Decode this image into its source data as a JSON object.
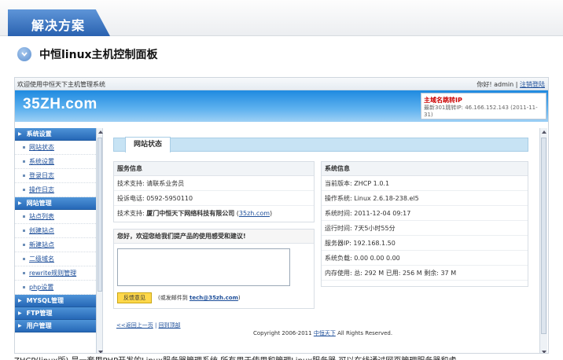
{
  "banner": {
    "title": "解决方案"
  },
  "section": {
    "title": "中恒linux主机控制面板"
  },
  "panel_ui": {
    "welcome": "欢迎使用中恒天下主机管理系统",
    "user_prefix": "你好!",
    "username": "admin",
    "separator": "|",
    "logout": "注销登陆",
    "logo": "35ZH.com",
    "notice_title": "主域名跳转IP",
    "notice_text": "最新301跳转IP: 46.166.152.143 (2011-11-31)"
  },
  "sidebar": {
    "groups": [
      {
        "label": "系统设置",
        "items": [
          "网站状态",
          "系统设置",
          "登录日志",
          "操作日志"
        ]
      },
      {
        "label": "网站管理",
        "items": [
          "站点列表",
          "创建站点",
          "新建站点",
          "二级域名",
          "rewrite规则管理",
          "php设置"
        ]
      },
      {
        "label": "MYSQL管理",
        "items": []
      },
      {
        "label": "FTP管理",
        "items": []
      },
      {
        "label": "用户管理",
        "items": []
      }
    ]
  },
  "main": {
    "tab": "网站状态",
    "service": {
      "title": "服务信息",
      "tech_support": "技术支持: 请联系业务员",
      "complaint": "投诉电话: 0592-5950110",
      "tech_label": "技术支持:",
      "tech_company": "厦门中恒天下网络科技有限公司",
      "tech_link": "35zh.com"
    },
    "system": {
      "title": "系统信息",
      "rows": [
        "当前版本: ZHCP 1.0.1",
        "操作系统: Linux 2.6.18-238.el5",
        "系统时间: 2011-12-04 09:17",
        "运行时间: 7天5小时55分",
        "服务器IP: 192.168.1.50",
        "系统负载: 0.00    0.00    0.00",
        "内存使用: 总: 292 M    已用: 256 M    剩余: 37 M"
      ]
    },
    "feedback": {
      "title": "您好，欢迎您给我们提产品的使用感受和建议!",
      "button": "反馈意见",
      "note_prefix": "(或发邮件到",
      "email": "tech@35zh.com",
      "note_suffix": ")"
    },
    "back_prev": "<<返回上一页",
    "back_home": "回到顶部",
    "copyright": "Copyright 2006-2011",
    "copyright_link": "中恒天下",
    "copyright_suffix": "All Rights Reserved."
  },
  "bottom_text": "ZHCP(linux版) 是一套用PHP开发的Linux服务器管理系统,所有用于使用和管理Linux服务器,可以在线通过网页管理服务器和虚"
}
